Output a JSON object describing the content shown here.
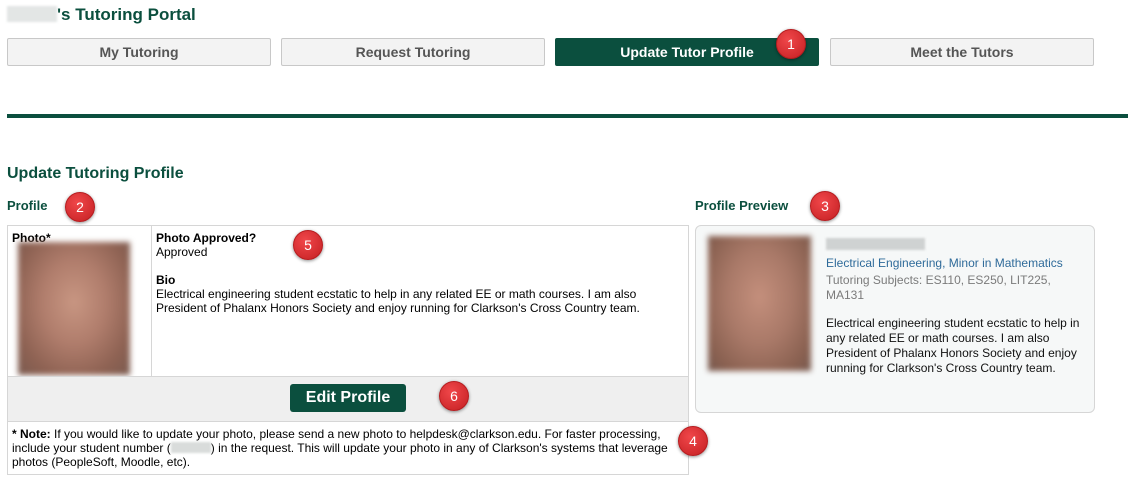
{
  "header": {
    "title_suffix": "'s Tutoring Portal"
  },
  "tabs": [
    {
      "label": "My Tutoring"
    },
    {
      "label": "Request Tutoring"
    },
    {
      "label": "Update Tutor Profile",
      "active": true
    },
    {
      "label": "Meet the Tutors"
    }
  ],
  "page": {
    "title": "Update Tutoring Profile",
    "profile_label": "Profile",
    "preview_label": "Profile Preview"
  },
  "profile": {
    "photo_label": "Photo*",
    "photo_approved_label": "Photo Approved?",
    "photo_approved_value": "Approved",
    "bio_label": "Bio",
    "bio_text": "Electrical engineering student ecstatic to help in any related EE or math courses. I am also President of Phalanx Honors Society and enjoy running for Clarkson's Cross Country team.",
    "edit_button": "Edit Profile",
    "note_prefix": "* Note:",
    "note_part1": " If you would like to update your photo, please send a new photo to helpdesk@clarkson.edu. For faster processing, include your student number (",
    "note_part2": ") in the request. This will update your photo in any of Clarkson's systems that leverage photos (PeopleSoft, Moodle, etc)."
  },
  "preview": {
    "major": "Electrical Engineering, Minor in Mathematics",
    "subjects": "Tutoring Subjects: ES110, ES250, LIT225, MA131",
    "bio": "Electrical engineering student ecstatic to help in any related EE or math courses. I am also President of Phalanx Honors Society and enjoy running for Clarkson's Cross Country team."
  },
  "annotations": [
    "1",
    "2",
    "3",
    "4",
    "5",
    "6"
  ],
  "colors": {
    "brand_green": "#0b4f3e",
    "badge_red": "#d62b2e",
    "link_blue": "#2f6b9a"
  }
}
